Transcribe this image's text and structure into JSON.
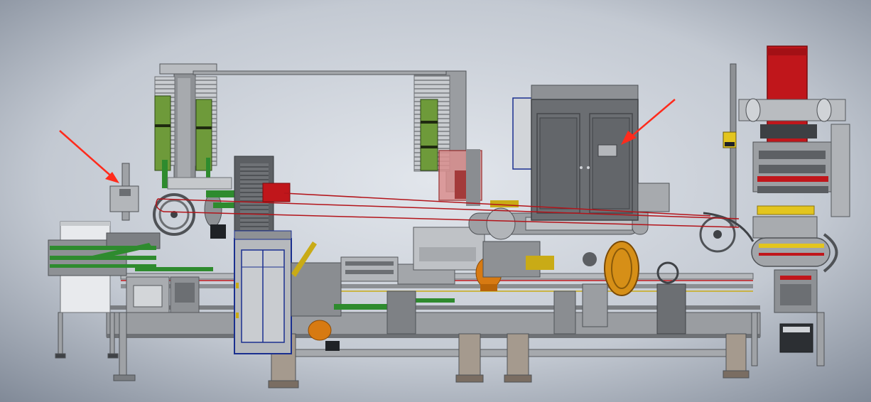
{
  "scene": {
    "subject": "cad-machine-assembly-render",
    "colors": {
      "background_center": "#dde2ea",
      "background_edge": "#7f8896",
      "frame": "#8c8f93",
      "frame_dark": "#5a5d61",
      "frame_light": "#b9bcc0",
      "green_part": "#2e8b2e",
      "green_panel": "#6e9a3a",
      "red_part": "#c0161b",
      "orange_part": "#d77a12",
      "yellow_part": "#e3c51e",
      "blue_outline": "#1a2f8f",
      "cabinet": "#6b6e72",
      "arrow": "#ff2b1c"
    },
    "annotations": [
      {
        "name": "left-arrow",
        "points_to": "left-guard-bracket"
      },
      {
        "name": "right-arrow",
        "points_to": "control-cabinet-nameplate"
      }
    ]
  }
}
